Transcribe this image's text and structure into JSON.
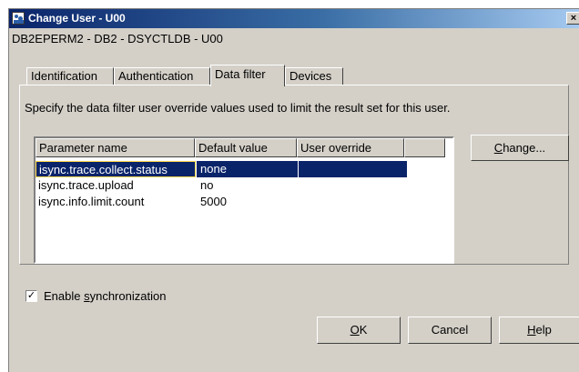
{
  "window": {
    "title": "Change User - U00",
    "close_glyph": "×"
  },
  "subtitle": "DB2EPERM2 - DB2 - DSYCTLDB - U00",
  "tabs": [
    {
      "label": "Identification",
      "active": false
    },
    {
      "label": "Authentication",
      "active": false
    },
    {
      "label": "Data filter",
      "active": true
    },
    {
      "label": "Devices",
      "active": false
    }
  ],
  "description": "Specify the data filter user override values used to limit the result set for this user.",
  "table": {
    "columns": [
      "Parameter name",
      "Default value",
      "User override"
    ],
    "rows": [
      {
        "parameter": "isync.trace.collect.status",
        "default": "none",
        "override": ""
      },
      {
        "parameter": "isync.trace.upload",
        "default": "no",
        "override": ""
      },
      {
        "parameter": "isync.info.limit.count",
        "default": "5000",
        "override": ""
      }
    ],
    "selected_row": 0
  },
  "buttons": {
    "change": {
      "label": "Change...",
      "accel": "C",
      "rest": "hange..."
    },
    "ok": {
      "label": "OK",
      "accel": "O",
      "rest": "K"
    },
    "cancel": {
      "label": "Cancel"
    },
    "help": {
      "label": "Help",
      "accel": "H",
      "rest": "elp"
    }
  },
  "checkbox": {
    "label_pre": "Enable ",
    "accel": "s",
    "label_post": "ynchronization",
    "checked": true,
    "check_glyph": "✓"
  },
  "colors": {
    "titlebar_start": "#0a246a",
    "selection": "#0a246a",
    "focus_border": "#ffd84a",
    "dialog_bg": "#d4d0c8"
  }
}
